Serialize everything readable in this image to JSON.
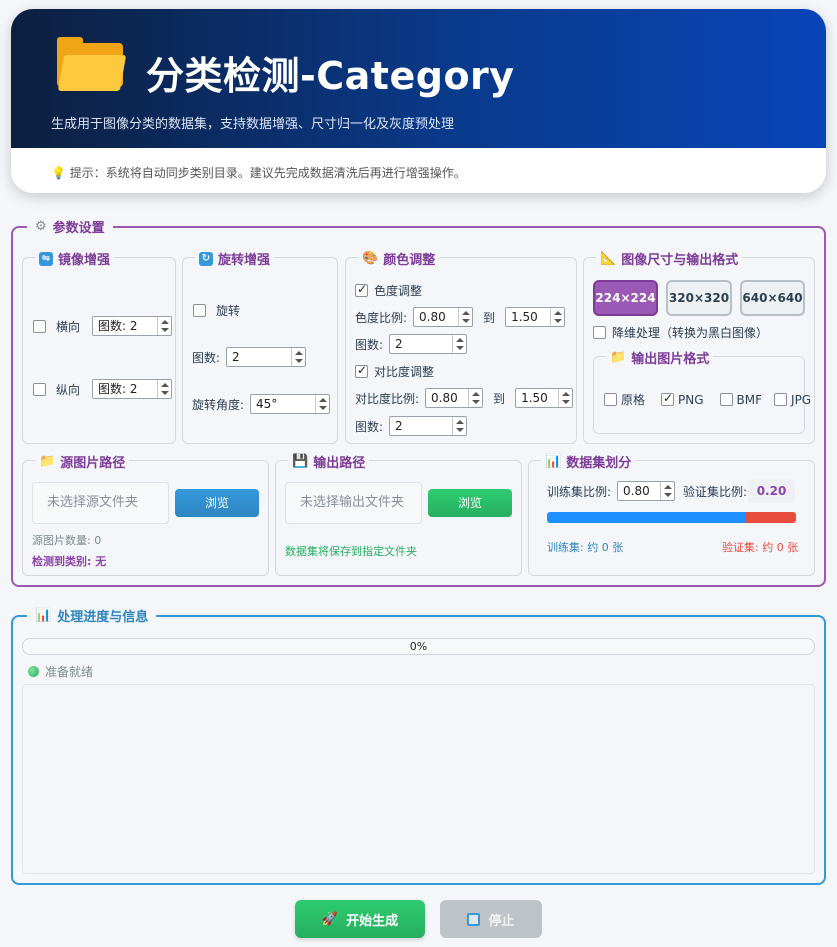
{
  "header": {
    "title": "分类检测-Category",
    "subtitle": "生成用于图像分类的数据集，支持数据增强、尺寸归一化及灰度预处理",
    "tip": "提示：系统将自动同步类别目录。建议先完成数据清洗后再进行增强操作。"
  },
  "params": {
    "legend": "参数设置",
    "mirror": {
      "legend": "镜像增强",
      "horizontal_label": "横向",
      "horizontal_count": "图数: 2",
      "vertical_label": "纵向",
      "vertical_count": "图数: 2"
    },
    "rotate": {
      "legend": "旋转增强",
      "rotate_label": "旋转",
      "count_label": "图数:",
      "count_value": "2",
      "angle_label": "旋转角度:",
      "angle_value": "45°"
    },
    "color": {
      "legend": "颜色调整",
      "hue_label": "色度调整",
      "hue_ratio_label": "色度比例:",
      "hue_from": "0.80",
      "to_label": "到",
      "hue_to": "1.50",
      "hue_count_label": "图数:",
      "hue_count": "2",
      "contrast_label": "对比度调整",
      "contrast_ratio_label": "对比度比例:",
      "contrast_from": "0.80",
      "contrast_to": "1.50",
      "contrast_count_label": "图数:",
      "contrast_count": "2"
    },
    "size": {
      "legend": "图像尺寸与输出格式",
      "options": [
        "224×224",
        "320×320",
        "640×640"
      ],
      "grayscale_label": "降维处理（转换为黑白图像）",
      "format_legend": "输出图片格式",
      "formats": [
        "原格",
        "PNG",
        "BMF",
        "JPG"
      ]
    },
    "source": {
      "legend": "源图片路径",
      "placeholder": "未选择源文件夹",
      "browse": "浏览",
      "count": "源图片数量: 0",
      "classes": "检测到类别: 无"
    },
    "output": {
      "legend": "输出路径",
      "placeholder": "未选择输出文件夹",
      "browse": "浏览",
      "note": "数据集将保存到指定文件夹"
    },
    "split": {
      "legend": "数据集划分",
      "train_label": "训练集比例:",
      "train_value": "0.80",
      "val_label": "验证集比例:",
      "val_value": "0.20",
      "train_fraction": 0.8,
      "train_count": "训练集: 约 0 张",
      "val_count": "验证集: 约 0 张"
    }
  },
  "progress": {
    "legend": "处理进度与信息",
    "percent": "0%",
    "status": "准备就绪"
  },
  "actions": {
    "start": "开始生成",
    "stop": "停止"
  },
  "colors": {
    "params_border": "#9b59b6",
    "progress_border": "#3498db",
    "train_bar": "#1e90ff",
    "val_bar": "#e74c3c"
  }
}
